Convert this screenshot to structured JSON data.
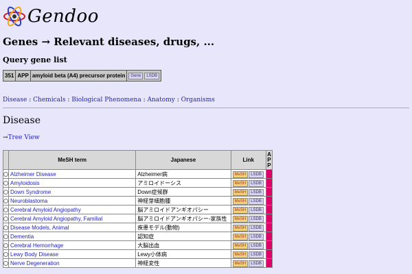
{
  "logo": {
    "text": "Gendoo"
  },
  "title": "Genes → Relevant diseases, drugs, ...",
  "query_label": "Query gene list",
  "gene": {
    "id": "351",
    "symbol": "APP",
    "name": "amyloid beta (A4) precursor protein",
    "gene_btn": "Gene",
    "lsdb_btn": "LSDB"
  },
  "categories": [
    "Disease",
    "Chemicals",
    "Biological Phenomena",
    "Anatomy",
    "Organisms"
  ],
  "separator": ":",
  "section_title": "Disease",
  "tree_arrow": "→",
  "tree_view": "Tree View",
  "table": {
    "headers": {
      "mesh": "MeSH term",
      "ja": "Japanese",
      "link": "Link",
      "app": "APP"
    },
    "mesh_btn": "MeSH",
    "lsdb_btn": "LSDB",
    "rows": [
      {
        "term": "Alzheimer Disease",
        "ja": "Alzheimer病"
      },
      {
        "term": "Amyloidosis",
        "ja": "アミロイドーシス"
      },
      {
        "term": "Down Syndrome",
        "ja": "Down症候群"
      },
      {
        "term": "Neuroblastoma",
        "ja": "神経芽細胞腫"
      },
      {
        "term": "Cerebral Amyloid Angiopathy",
        "ja": "脳アミロイドアンギオパシー"
      },
      {
        "term": "Cerebral Amyloid Angiopathy, Familial",
        "ja": "脳アミロイドアンギオパシー-家族性"
      },
      {
        "term": "Disease Models, Animal",
        "ja": "疾患モデル(動物)"
      },
      {
        "term": "Dementia",
        "ja": "認知症"
      },
      {
        "term": "Cerebral Hemorrhage",
        "ja": "大脳出血"
      },
      {
        "term": "Lewy Body Disease",
        "ja": "Lewy小体病"
      },
      {
        "term": "Nerve Degeneration",
        "ja": "神経変性"
      }
    ]
  },
  "colors": {
    "background": "#e8e6fb",
    "link": "#1f1fb8",
    "app_bar": "#e0006a"
  }
}
